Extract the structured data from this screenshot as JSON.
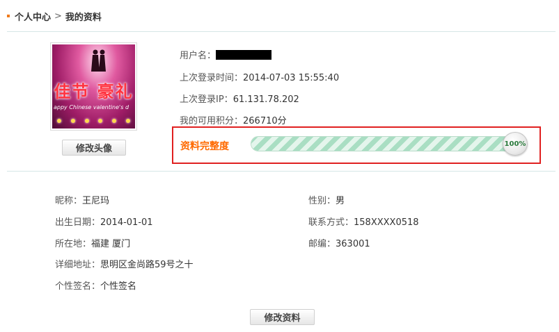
{
  "breadcrumb": {
    "items": [
      "个人中心",
      "我的资料"
    ],
    "separator": ">"
  },
  "avatar": {
    "image_text_main": "佳节 豪礼",
    "image_text_sub": "appy Chinese valentine's d",
    "edit_button": "修改头像"
  },
  "account": {
    "username_label": "用户名：",
    "last_login_time_label": "上次登录时间：",
    "last_login_time": "2014-07-03 15:55:40",
    "last_login_ip_label": "上次登录IP：",
    "last_login_ip": "61.131.78.202",
    "points_label": "我的可用积分：",
    "points": "266710分"
  },
  "completeness": {
    "label": "资料完整度",
    "percent_text": "100%",
    "value": 1.0
  },
  "profile": {
    "nickname_label": "昵称：",
    "nickname": "王尼玛",
    "gender_label": "性别：",
    "gender": "男",
    "birthday_label": "出生日期：",
    "birthday": "2014-01-01",
    "contact_label": "联系方式：",
    "contact": "158XXXX0518",
    "location_label": "所在地：",
    "location": "福建 厦门",
    "zip_label": "邮编：",
    "zip": "363001",
    "address_label": "详细地址：",
    "address": "思明区金尚路59号之十",
    "signature_label": "个性签名：",
    "signature": "个性签名"
  },
  "actions": {
    "edit_profile_button": "修改资料"
  },
  "colors": {
    "accent_orange": "#ff6a00",
    "highlight_red": "#e02020",
    "progress_green": "#a9dec3",
    "divider": "#d5e6e6"
  }
}
